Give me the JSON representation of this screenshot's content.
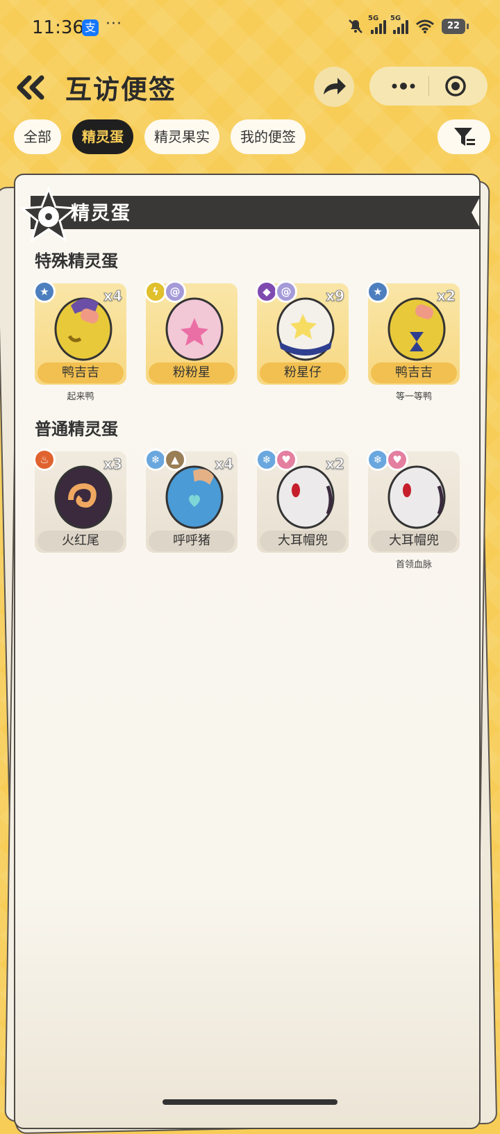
{
  "status": {
    "time": "11:36",
    "alipay_badge": "支",
    "dots": "···",
    "net1": "5G",
    "net2": "5G",
    "battery": "22"
  },
  "header": {
    "title": "互访便签"
  },
  "tabs": [
    {
      "label": "全部",
      "active": false
    },
    {
      "label": "精灵蛋",
      "active": true
    },
    {
      "label": "精灵果实",
      "active": false
    },
    {
      "label": "我的便签",
      "active": false
    }
  ],
  "panel": {
    "banner_title": "精灵蛋"
  },
  "sections": {
    "special": {
      "title": "特殊精灵蛋"
    },
    "normal": {
      "title": "普通精灵蛋"
    }
  },
  "special_cards": [
    {
      "name": "鸭吉吉",
      "count": "x4",
      "sub": "起来鸭",
      "types": [
        "star"
      ]
    },
    {
      "name": "粉粉星",
      "count": "",
      "sub": "",
      "types": [
        "electric",
        "psychic"
      ]
    },
    {
      "name": "粉星仔",
      "count": "x9",
      "sub": "",
      "types": [
        "ghost",
        "psychic"
      ]
    },
    {
      "name": "鸭吉吉",
      "count": "x2",
      "sub": "等一等鸭",
      "types": [
        "star"
      ]
    }
  ],
  "normal_cards": [
    {
      "name": "火红尾",
      "count": "x3",
      "sub": "",
      "types": [
        "fire"
      ]
    },
    {
      "name": "呼呼猪",
      "count": "x4",
      "sub": "",
      "types": [
        "ice",
        "ground"
      ]
    },
    {
      "name": "大耳帽兜",
      "count": "x2",
      "sub": "",
      "types": [
        "ice",
        "cute"
      ]
    },
    {
      "name": "大耳帽兜",
      "count": "",
      "sub": "首领血脉",
      "types": [
        "ice",
        "cute"
      ]
    }
  ],
  "colors": {
    "background": "#f7cd57",
    "tab_active_bg": "#1f1f1f",
    "tab_active_text": "#f7cd57",
    "special_label": "#f2c050",
    "normal_label": "#ddd5c7"
  }
}
